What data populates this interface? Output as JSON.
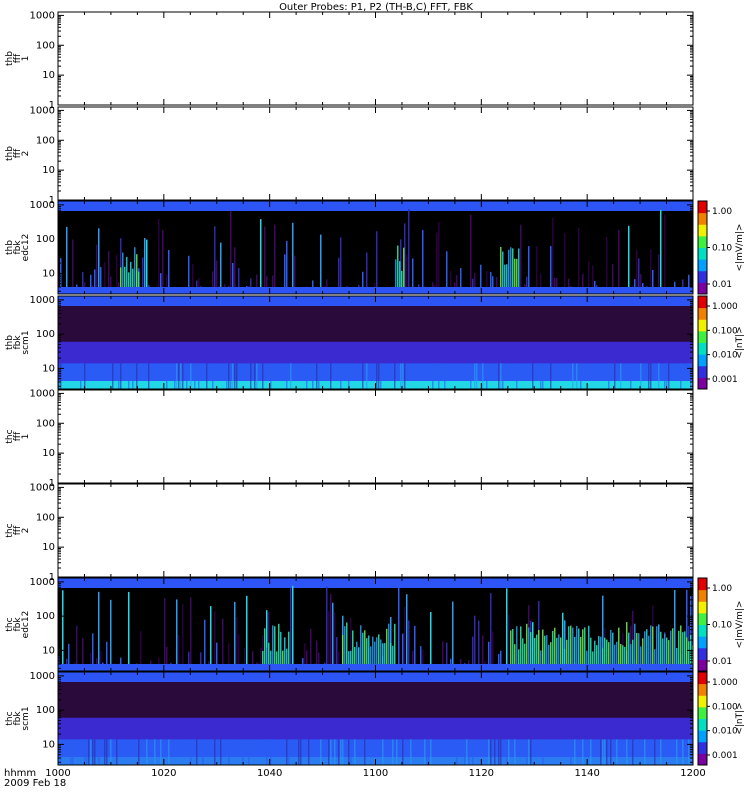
{
  "chart_data": {
    "title": "Outer Probes: P1, P2 (TH-B,C) FFT, FBK",
    "type": "heatmap",
    "x_label_line1": "hhmm",
    "x_label_line2": "2009 Feb 18",
    "x_ticks": [
      "1000",
      "1020",
      "1040",
      "1100",
      "1120",
      "1140",
      "1200"
    ],
    "x_range": [
      600,
      720
    ],
    "panels": [
      {
        "id": "thb-fff-1",
        "ylabel": [
          "thb",
          "fff",
          "1"
        ],
        "y_ticks": [
          "1",
          "10",
          "100",
          "1000"
        ],
        "has_data": false,
        "scale": "log"
      },
      {
        "id": "thb-fff-2",
        "ylabel": [
          "thb",
          "fff",
          "2"
        ],
        "y_ticks": [
          "1",
          "10",
          "100",
          "1000"
        ],
        "has_data": false,
        "scale": "log"
      },
      {
        "id": "thb-fbk-edc12",
        "ylabel": [
          "thb",
          "fbk",
          "edc12"
        ],
        "y_ticks": [
          "10",
          "100",
          "1000"
        ],
        "has_data": true,
        "scale": "log",
        "colorbar": {
          "ticks": [
            "1.00",
            "0.10",
            "0.01"
          ],
          "unit": "<|mV/m|>"
        }
      },
      {
        "id": "thb-fbk-scm1",
        "ylabel": [
          "thb",
          "fbk",
          "scm1"
        ],
        "y_ticks": [
          "10",
          "100",
          "1000"
        ],
        "has_data": true,
        "scale": "log",
        "colorbar": {
          "ticks": [
            "1.000",
            "0.100",
            "0.010",
            "0.001"
          ],
          "unit": "<|nT|>"
        }
      },
      {
        "id": "thc-fff-1",
        "ylabel": [
          "thc",
          "fff",
          "1"
        ],
        "y_ticks": [
          "1",
          "10",
          "100",
          "1000"
        ],
        "has_data": false,
        "scale": "log"
      },
      {
        "id": "thc-fff-2",
        "ylabel": [
          "thc",
          "fff",
          "2"
        ],
        "y_ticks": [
          "1",
          "10",
          "100",
          "1000"
        ],
        "has_data": false,
        "scale": "log"
      },
      {
        "id": "thc-fbk-edc12",
        "ylabel": [
          "thc",
          "fbk",
          "edc12"
        ],
        "y_ticks": [
          "10",
          "100",
          "1000"
        ],
        "has_data": true,
        "scale": "log",
        "colorbar": {
          "ticks": [
            "1.00",
            "0.10",
            "0.01"
          ],
          "unit": "<|mV/m|>"
        }
      },
      {
        "id": "thc-fbk-scm1",
        "ylabel": [
          "thc",
          "fbk",
          "scm1"
        ],
        "y_ticks": [
          "10",
          "100",
          "1000"
        ],
        "has_data": true,
        "scale": "log",
        "colorbar": {
          "ticks": [
            "1.000",
            "0.100",
            "0.010",
            "0.001"
          ],
          "unit": "<|nT|>"
        }
      }
    ]
  }
}
